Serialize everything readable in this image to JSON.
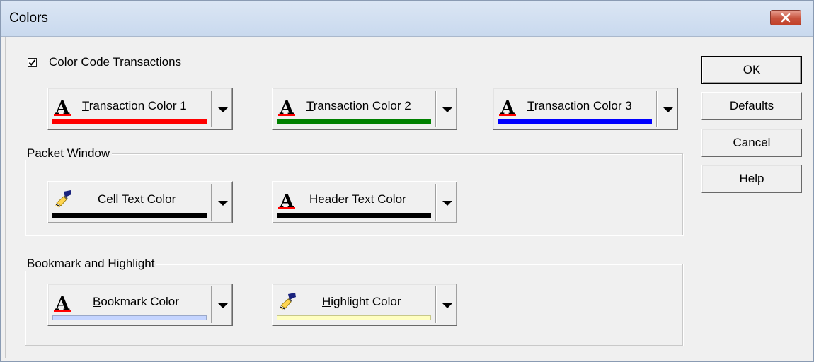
{
  "window": {
    "title": "Colors",
    "close_icon": "close-x-icon"
  },
  "color_code": {
    "label": "Color Code Transactions",
    "checked": true
  },
  "transaction_buttons": [
    {
      "label": "Transaction Color 1",
      "mnemonic": "T",
      "icon": "font-A-icon",
      "color": "#ff0000"
    },
    {
      "label": "Transaction Color 2",
      "mnemonic": "T",
      "icon": "font-A-icon",
      "color": "#008000"
    },
    {
      "label": "Transaction Color 3",
      "mnemonic": "T",
      "icon": "font-A-icon",
      "color": "#0000ff"
    }
  ],
  "packet_window": {
    "title": "Packet Window",
    "buttons": [
      {
        "label": "Cell Text Color",
        "mnemonic": "C",
        "icon": "paintbrush-icon",
        "color": "#000000"
      },
      {
        "label": "Header Text Color",
        "mnemonic": "H",
        "icon": "font-A-icon",
        "color": "#000000"
      }
    ]
  },
  "bookmark_highlight": {
    "title": "Bookmark and Highlight",
    "buttons": [
      {
        "label": "Bookmark Color",
        "mnemonic": "B",
        "icon": "font-A-icon",
        "color": "#c4d4ff"
      },
      {
        "label": "Highlight Color",
        "mnemonic": "H",
        "icon": "paintbrush-icon",
        "color": "#ffffc0"
      }
    ]
  },
  "actions": {
    "ok": "OK",
    "defaults": "Defaults",
    "cancel": "Cancel",
    "help": "Help"
  }
}
